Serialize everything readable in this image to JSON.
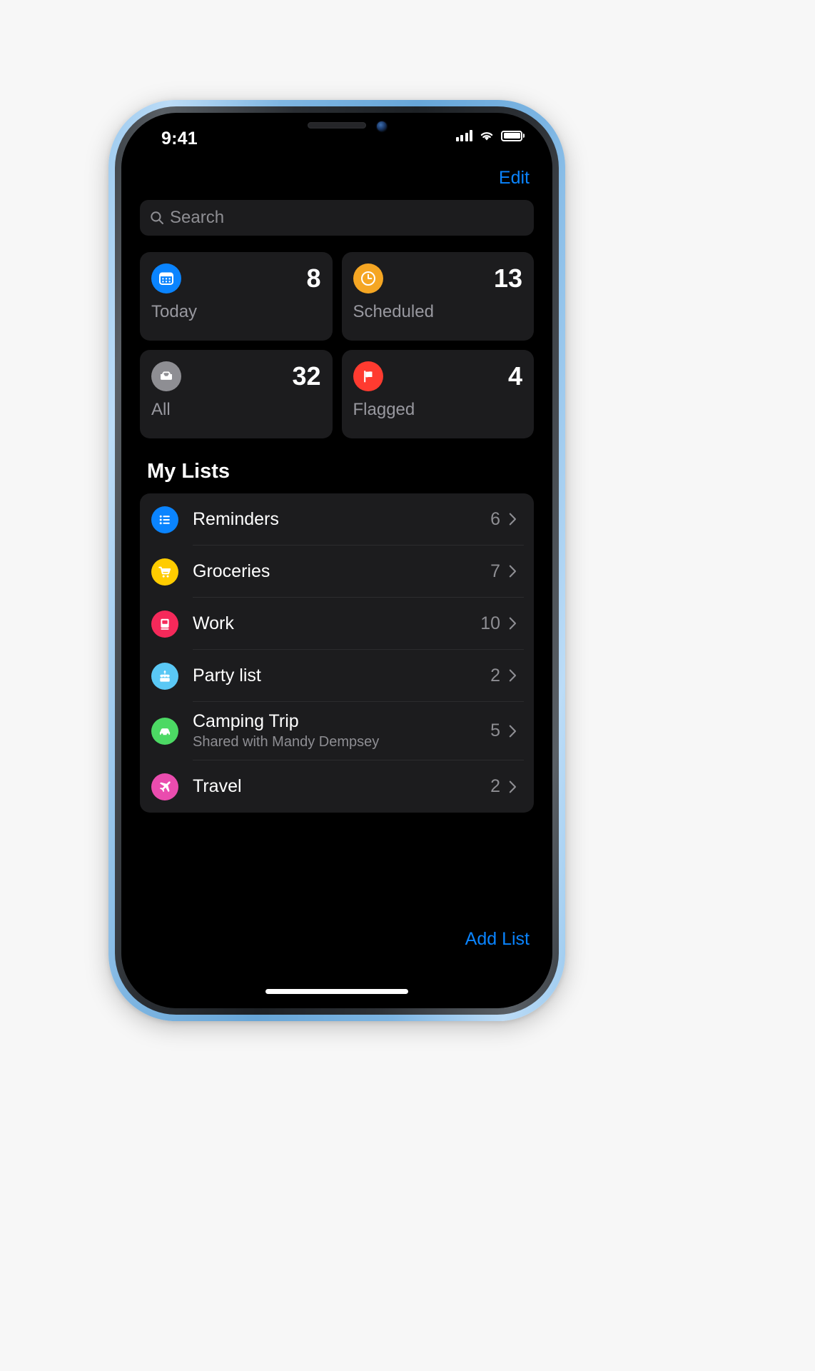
{
  "device": {
    "frame_color": "#7fb6e2",
    "screen_bg": "#000000"
  },
  "status_bar": {
    "time": "9:41",
    "signal_icon": "cellular-signal-icon",
    "wifi_icon": "wifi-icon",
    "battery_icon": "battery-icon"
  },
  "navigation": {
    "edit_label": "Edit",
    "accent_color": "#0a84ff"
  },
  "search": {
    "placeholder": "Search",
    "icon": "search-icon",
    "value": ""
  },
  "summary": {
    "cards": [
      {
        "key": "today",
        "label": "Today",
        "count": "8",
        "icon": "calendar-icon",
        "color": "#0a84ff"
      },
      {
        "key": "scheduled",
        "label": "Scheduled",
        "count": "13",
        "icon": "clock-icon",
        "color": "#f5a623"
      },
      {
        "key": "all",
        "label": "All",
        "count": "32",
        "icon": "inbox-tray-icon",
        "color": "#8e8e93"
      },
      {
        "key": "flagged",
        "label": "Flagged",
        "count": "4",
        "icon": "flag-icon",
        "color": "#ff3b30"
      }
    ]
  },
  "my_lists": {
    "title": "My Lists",
    "items": [
      {
        "key": "reminders",
        "name": "Reminders",
        "subtitle": "",
        "count": "6",
        "icon": "bulleted-list-icon",
        "color": "#0a84ff"
      },
      {
        "key": "groceries",
        "name": "Groceries",
        "subtitle": "",
        "count": "7",
        "icon": "shopping-cart-icon",
        "color": "#ffcc00"
      },
      {
        "key": "work",
        "name": "Work",
        "subtitle": "",
        "count": "10",
        "icon": "book-icon",
        "color": "#f5295a"
      },
      {
        "key": "party",
        "name": "Party list",
        "subtitle": "",
        "count": "2",
        "icon": "birthday-cake-icon",
        "color": "#5ac8f5"
      },
      {
        "key": "camping",
        "name": "Camping Trip",
        "subtitle": "Shared with Mandy Dempsey",
        "count": "5",
        "icon": "car-icon",
        "color": "#4cd964"
      },
      {
        "key": "travel",
        "name": "Travel",
        "subtitle": "",
        "count": "2",
        "icon": "airplane-icon",
        "color": "#ea4cae"
      }
    ]
  },
  "footer": {
    "add_list_label": "Add List"
  }
}
